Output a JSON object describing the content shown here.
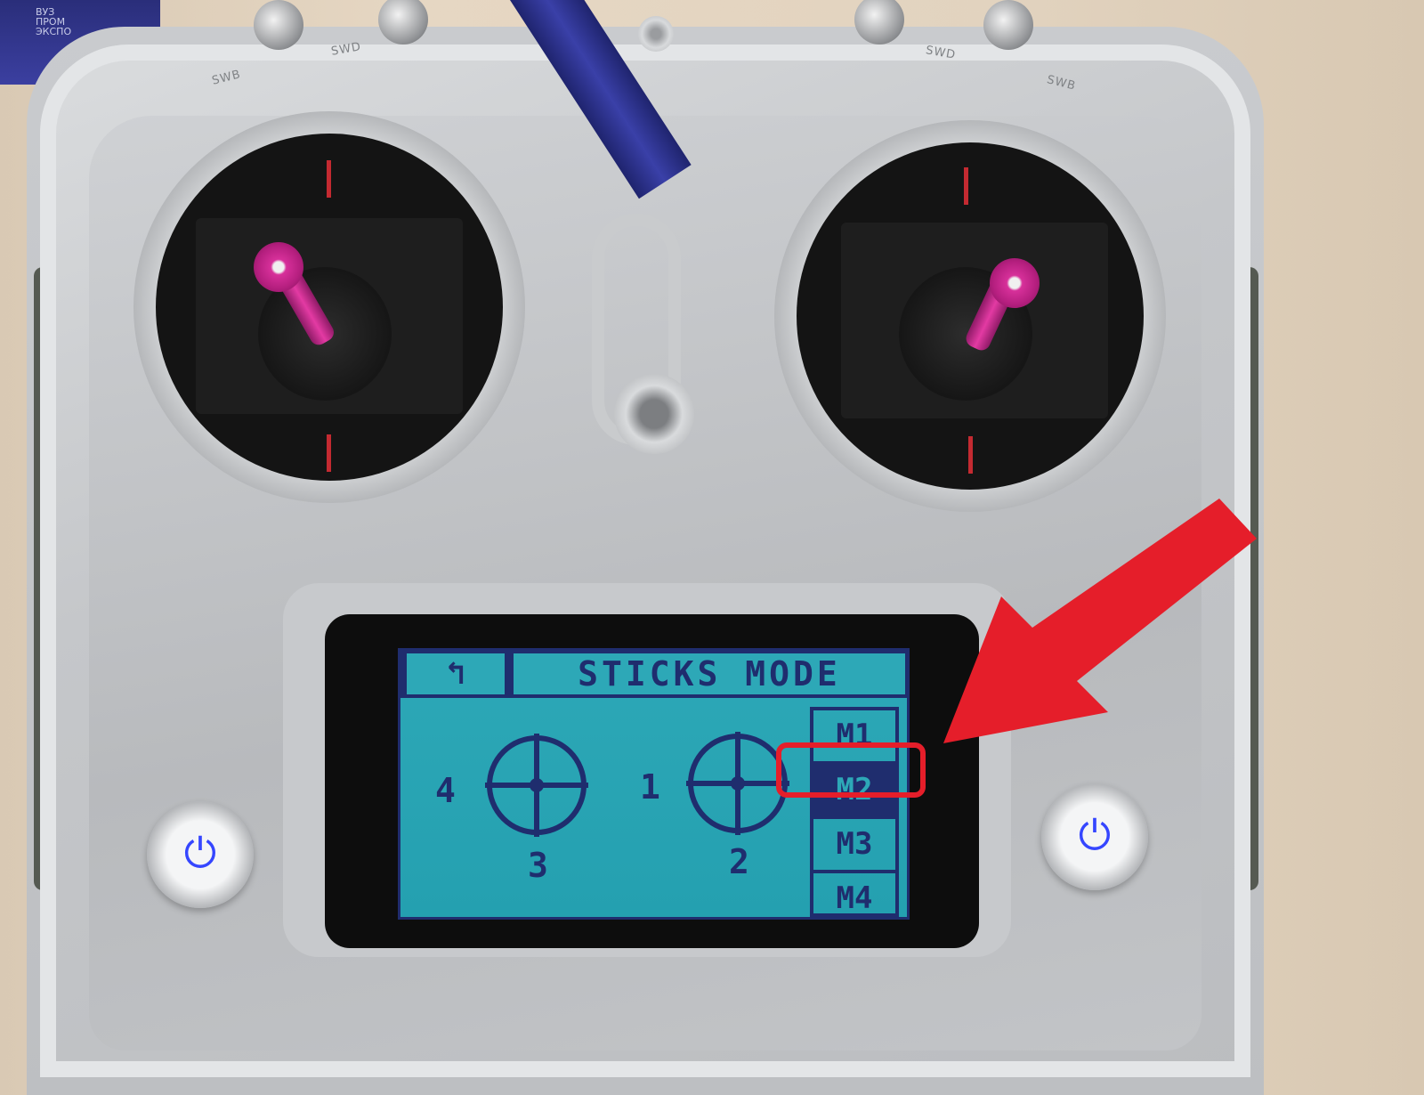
{
  "lanyard": {
    "logo_text": [
      "ВУЗ",
      "ПРОМ",
      "ЭКСПО"
    ]
  },
  "switches": {
    "labels": [
      "SWB",
      "SWD",
      "SWD",
      "SWB"
    ]
  },
  "lcd": {
    "title": "STICKS MODE",
    "back_glyph": "↰",
    "modes": [
      "M1",
      "M2",
      "M3",
      "M4"
    ],
    "selected_mode": "M2",
    "left_stick": {
      "left_label": "4",
      "bottom_label": "3"
    },
    "right_stick": {
      "left_label": "1",
      "bottom_label": "2"
    }
  },
  "power_glyph": "⏻",
  "colors": {
    "lcd_background": "#2da8b7",
    "lcd_foreground": "#1f2d6e",
    "annotation_red": "#e51e2a",
    "stick_accent": "#d7309a",
    "power_blue": "#3546ff"
  }
}
